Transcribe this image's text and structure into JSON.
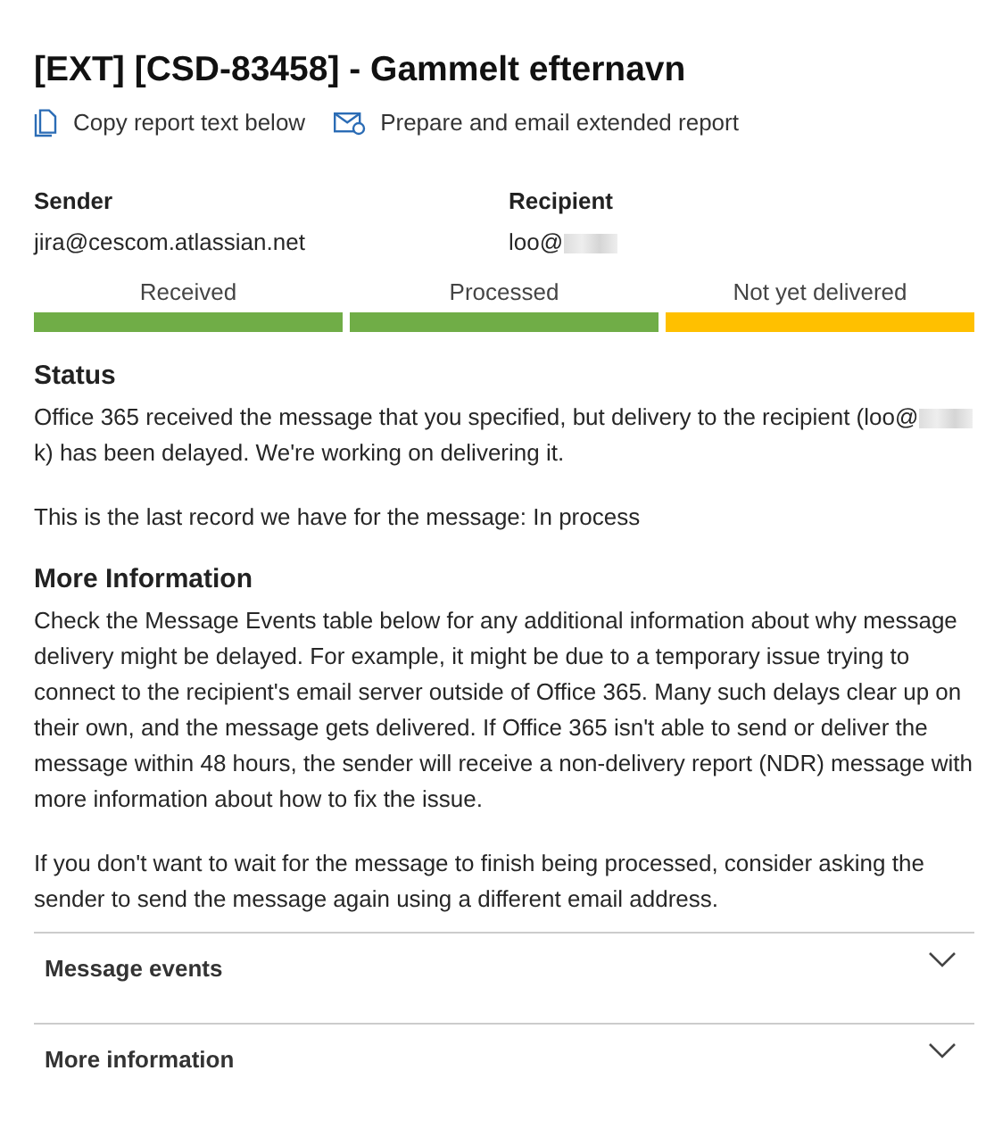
{
  "title": "[EXT] [CSD-83458] - Gammelt efternavn",
  "actions": [
    {
      "kind": "copy",
      "label": "Copy report text below"
    },
    {
      "kind": "email",
      "label": "Prepare and email extended report"
    }
  ],
  "sender": {
    "label": "Sender",
    "value": "jira@cescom.atlassian.net"
  },
  "recipient": {
    "label": "Recipient",
    "value": "loo@"
  },
  "stages": [
    {
      "label": "Received",
      "color": "#70ad47"
    },
    {
      "label": "Processed",
      "color": "#70ad47"
    },
    {
      "label": "Not yet delivered",
      "color": "#ffc000"
    }
  ],
  "status": {
    "heading": "Status",
    "text_before": "Office 365 received the message that you specified, but delivery to the recipient (loo@",
    "text_after": "k) has been delayed. We're working on delivering it.",
    "last_record": "This is the last record we have for the message: In process"
  },
  "more_info": {
    "heading": "More Information",
    "paragraphs": [
      "Check the Message Events table below for any additional information about why message delivery might be delayed. For example, it might be due to a temporary issue trying to connect to the recipient's email server outside of Office 365. Many such delays clear up on their own, and the message gets delivered. If Office 365 isn't able to send or deliver the message within 48 hours, the sender will receive a non-delivery report (NDR) message with more information about how to fix the issue.",
      "If you don't want to wait for the message to finish being processed, consider asking the sender to send the message again using a different email address."
    ]
  },
  "sections": [
    {
      "label": "Message events",
      "expanded": false
    },
    {
      "label": "More information",
      "expanded": false
    }
  ]
}
